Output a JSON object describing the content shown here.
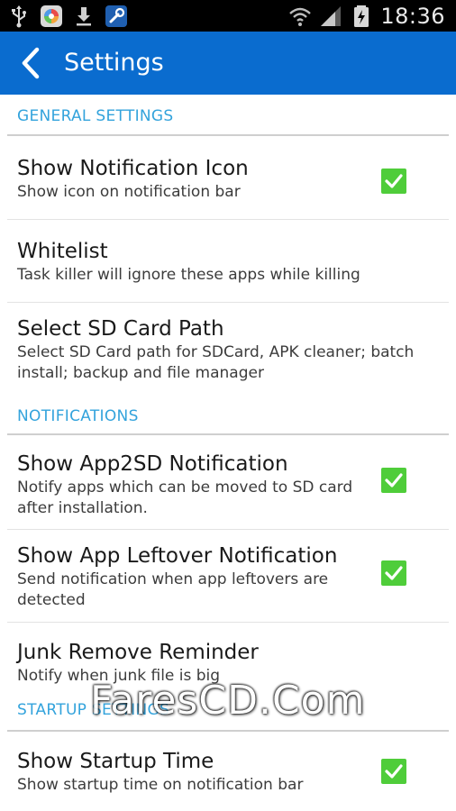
{
  "status_bar": {
    "time": "18:36",
    "left_icons": [
      "usb-icon",
      "app-icon",
      "download-icon",
      "tools-icon"
    ],
    "right_icons": [
      "wifi-icon",
      "signal-icon",
      "battery-charging-icon"
    ]
  },
  "action_bar": {
    "title": "Settings",
    "color": "#0a6ccf"
  },
  "colors": {
    "section_header": "#33a3dc",
    "checkbox": "#4fcd3a"
  },
  "sections": [
    {
      "header": "GENERAL SETTINGS",
      "items": [
        {
          "title": "Show Notification Icon",
          "summary": "Show icon on notification bar",
          "checked": true
        },
        {
          "title": "Whitelist",
          "summary": "Task killer will ignore these apps while killing"
        },
        {
          "title": "Select SD Card Path",
          "summary": "Select SD Card path for SDCard, APK cleaner; batch install; backup and file manager"
        }
      ]
    },
    {
      "header": "NOTIFICATIONS",
      "items": [
        {
          "title": "Show App2SD Notification",
          "summary": "Notify apps which can be moved to SD card after installation.",
          "checked": true
        },
        {
          "title": "Show App Leftover Notification",
          "summary": "Send notification when app leftovers are detected",
          "checked": true
        },
        {
          "title": "Junk Remove Reminder",
          "summary": "Notify when junk file is big"
        }
      ]
    },
    {
      "header": "STARTUP SETTINGS",
      "items": [
        {
          "title": "Show Startup Time",
          "summary": "Show startup time on notification bar",
          "checked": true
        }
      ]
    }
  ],
  "watermark": "FaresCD.Com"
}
